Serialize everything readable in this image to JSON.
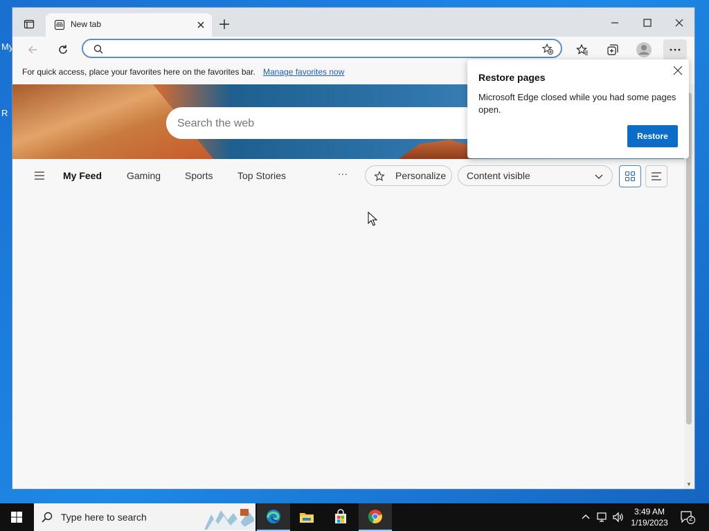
{
  "desktop": {
    "labels": [
      "My",
      "R"
    ]
  },
  "browser": {
    "tab": {
      "title": "New tab"
    },
    "address": {
      "value": "",
      "placeholder": ""
    },
    "favorites_bar": {
      "message": "For quick access, place your favorites here on the favorites bar.",
      "link": "Manage favorites now"
    },
    "hero_search": {
      "placeholder": "Search the web"
    },
    "feed": {
      "tabs": [
        "My Feed",
        "Gaming",
        "Sports",
        "Top Stories"
      ],
      "active_tab": "My Feed",
      "more": "···",
      "personalize": "Personalize",
      "content_select": "Content visible"
    },
    "popup": {
      "title": "Restore pages",
      "body": "Microsoft Edge closed while you had some pages open.",
      "button": "Restore"
    }
  },
  "taskbar": {
    "search_placeholder": "Type here to search",
    "apps": [
      "edge-icon",
      "file-explorer-icon",
      "store-icon",
      "chrome-icon"
    ],
    "time": "3:49 AM",
    "date": "1/19/2023",
    "notifications": "2"
  },
  "colors": {
    "accent": "#0b6dc8",
    "taskbar": "#101010",
    "link": "#1a5fb4"
  }
}
